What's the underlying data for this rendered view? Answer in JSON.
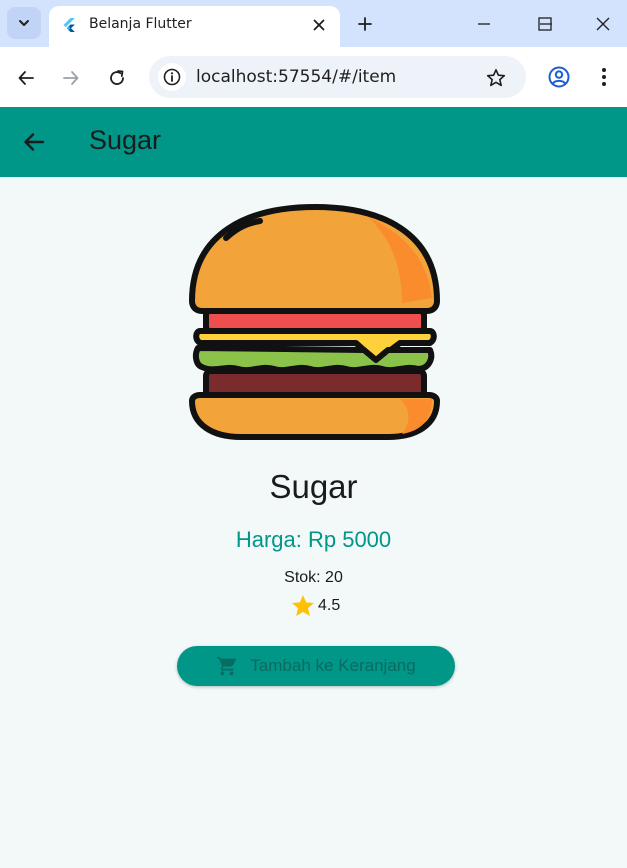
{
  "browser": {
    "tab_title": "Belanja Flutter",
    "url": "localhost:57554/#/item"
  },
  "appbar": {
    "title": "Sugar"
  },
  "product": {
    "name": "Sugar",
    "price_text": "Harga: Rp 5000",
    "stock_text": "Stok: 20",
    "rating": "4.5",
    "image_icon": "burger-image"
  },
  "cart_button": {
    "label": "Tambah ke Keranjang",
    "icon": "shopping-cart-icon"
  },
  "colors": {
    "primary": "#009688",
    "background": "#f2f9f8",
    "star": "#ffc107"
  }
}
